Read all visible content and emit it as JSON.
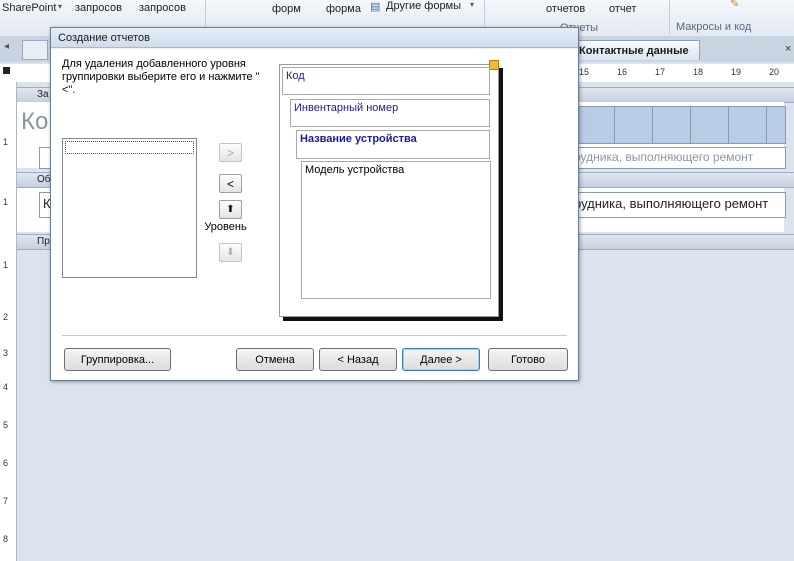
{
  "ribbon": {
    "sharepoint_label": "SharePoint",
    "queries_label_1": "запросов",
    "queries_label_2": "запросов",
    "forms_label_1": "форм",
    "forms_label_2": "форма",
    "other_forms_label": "Другие формы",
    "reports_label_1": "отчетов",
    "reports_label_2": "отчет",
    "reports_group": "Отчеты",
    "macros_group": "Макросы и код"
  },
  "doc_tab": {
    "label": "Контактные данные"
  },
  "ruler": {
    "numbers": [
      "15",
      "16",
      "17",
      "18",
      "19",
      "20"
    ],
    "vertical_numbers": [
      "1",
      "1",
      "1",
      "2",
      "3",
      "4",
      "5",
      "6",
      "7",
      "8"
    ]
  },
  "report": {
    "section_header": "За",
    "section_detail": "Об",
    "section_footer": "Пр",
    "title_fragment": "Ко",
    "field_fragment_1": "рудника, выполняющего ремонт",
    "field_fragment_2": "рудника, выполняющего ремонт",
    "detail_fragment": "К"
  },
  "dialog": {
    "title": "Создание отчетов",
    "instructions": "Для удаления добавленного уровня группировки выберите его и нажмите \"<\".",
    "btn_add": ">",
    "btn_remove": "<",
    "btn_up": "⬆",
    "btn_down": "⬇",
    "level_label": "Уровень",
    "preview": {
      "level_1": "Код",
      "level_2": "Инвентарный номер",
      "level_3": "Название устройства",
      "level_4": "Модель устройства"
    },
    "buttons": {
      "grouping": "Группировка...",
      "cancel": "Отмена",
      "back": "< Назад",
      "next": "Далее >",
      "finish": "Готово"
    }
  }
}
